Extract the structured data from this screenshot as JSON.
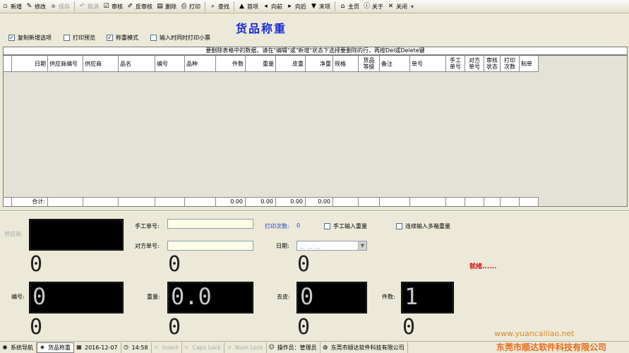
{
  "toolbar": {
    "items": [
      {
        "label": "新增",
        "icon": "new-icon",
        "glyph": "▫",
        "enabled": true
      },
      {
        "label": "修改",
        "icon": "edit-icon",
        "glyph": "✎",
        "enabled": true
      },
      {
        "label": "保存",
        "icon": "save-icon",
        "glyph": "▪",
        "enabled": false
      },
      {
        "label": "取消",
        "icon": "undo-icon",
        "glyph": "↶",
        "enabled": false
      },
      {
        "label": "审核",
        "icon": "audit-icon",
        "glyph": "☑",
        "enabled": true
      },
      {
        "label": "反审核",
        "icon": "unaudit-icon",
        "glyph": "✐",
        "enabled": true
      },
      {
        "label": "删除",
        "icon": "delete-icon",
        "glyph": "▤",
        "enabled": true
      },
      {
        "label": "打印",
        "icon": "print-icon",
        "glyph": "⎙",
        "enabled": true
      },
      {
        "label": "查找",
        "icon": "find-icon",
        "glyph": "⌕",
        "enabled": true
      },
      {
        "label": "首项",
        "icon": "first-icon",
        "glyph": "▲",
        "enabled": true
      },
      {
        "label": "向前",
        "icon": "prev-icon",
        "glyph": "◂",
        "enabled": true
      },
      {
        "label": "向后",
        "icon": "next-icon",
        "glyph": "▸",
        "enabled": true
      },
      {
        "label": "末项",
        "icon": "last-icon",
        "glyph": "▼",
        "enabled": true
      },
      {
        "label": "主页",
        "icon": "home-icon",
        "glyph": "⌂",
        "enabled": true
      },
      {
        "label": "关于",
        "icon": "about-icon",
        "glyph": "ⓘ",
        "enabled": true
      },
      {
        "label": "关闭",
        "icon": "close-icon",
        "glyph": "✕",
        "enabled": true
      }
    ]
  },
  "form": {
    "title": "货品称重",
    "options": [
      {
        "label": "复制新增选项",
        "checked": true
      },
      {
        "label": "打印预览",
        "checked": false
      },
      {
        "label": "称重模式",
        "checked": true
      },
      {
        "label": "输入时同时打印小票",
        "checked": false
      }
    ],
    "hint": "要删除表格中的数据，请在\"编辑\"或\"新增\"状态下选择要删除的行，再按Del或Delete键"
  },
  "grid": {
    "columns": [
      {
        "label": "",
        "w": 12,
        "align": "l"
      },
      {
        "label": "日期",
        "w": 51,
        "align": "r"
      },
      {
        "label": "供应商编号",
        "w": 50,
        "align": "l"
      },
      {
        "label": "供应商",
        "w": 50,
        "align": "l"
      },
      {
        "label": "品名",
        "w": 52,
        "align": "l"
      },
      {
        "label": "编号",
        "w": 42,
        "align": "l"
      },
      {
        "label": "品种",
        "w": 44,
        "align": "l"
      },
      {
        "label": "件数",
        "w": 42,
        "align": "r"
      },
      {
        "label": "重量",
        "w": 43,
        "align": "r"
      },
      {
        "label": "皮重",
        "w": 42,
        "align": "r"
      },
      {
        "label": "净重",
        "w": 39,
        "align": "r"
      },
      {
        "label": "规格",
        "w": 36,
        "align": "l"
      },
      {
        "label": "货品 等级",
        "w": 30,
        "align": "c"
      },
      {
        "label": "备注",
        "w": 43,
        "align": "l"
      },
      {
        "label": "单号",
        "w": 51,
        "align": "l"
      },
      {
        "label": "手工 单号",
        "w": 27,
        "align": "c"
      },
      {
        "label": "对方 单号",
        "w": 27,
        "align": "c"
      },
      {
        "label": "审核 状态",
        "w": 23,
        "align": "c"
      },
      {
        "label": "打印 次数",
        "w": 27,
        "align": "c"
      },
      {
        "label": "制单",
        "w": 27,
        "align": "l"
      }
    ],
    "footer": [
      "",
      "合计:",
      "",
      "",
      "",
      "",
      "",
      "0.00",
      "0.00",
      "0.00",
      "0.00",
      "",
      "",
      "",
      "",
      "",
      "",
      "",
      "",
      ""
    ]
  },
  "panel": {
    "supplier_label": "供应商:",
    "manual_no_label": "手工单号:",
    "their_no_label": "对方单号:",
    "print_count_label": "打印次数:",
    "print_count_value": "0",
    "manual_weight_label": "手工输入重量",
    "multi_weight_label": "连续输入多箱重量",
    "date_label": "日期:",
    "date_placeholder": "__-__-__",
    "status": "就绪......",
    "code_label": "编号:",
    "weight_label": "重量:",
    "tare_label": "去皮:",
    "pieces_label": "件数:",
    "code_display": "0",
    "weight_display": "0.0",
    "tare_display": "0",
    "pieces_display": "1",
    "zero": "0"
  },
  "taskbar": {
    "items": [
      {
        "label": "系统导航",
        "icon": "nav-icon",
        "glyph": "◉",
        "active": false,
        "dim": false
      },
      {
        "label": "货品称重",
        "icon": "form-icon",
        "glyph": "◈",
        "active": true,
        "dim": false
      },
      {
        "label": "2016-12-07",
        "icon": "calendar-icon",
        "glyph": "▦",
        "active": false,
        "dim": false
      },
      {
        "label": "14:58",
        "icon": "clock-icon",
        "glyph": "◷",
        "active": false,
        "dim": false
      },
      {
        "label": "Insert",
        "icon": "insert-icon",
        "glyph": "▫",
        "active": false,
        "dim": true
      },
      {
        "label": "Caps Lock",
        "icon": "capslock-icon",
        "glyph": "▫",
        "active": false,
        "dim": true
      },
      {
        "label": "Num Lock",
        "icon": "numlock-icon",
        "glyph": "▫",
        "active": false,
        "dim": true
      },
      {
        "label": "操作员：管理员",
        "icon": "user-icon",
        "glyph": "☺",
        "active": false,
        "dim": false
      },
      {
        "label": "东莞市顺达软件科技有限公司",
        "icon": "company-icon",
        "glyph": "◍",
        "active": false,
        "dim": false
      }
    ]
  },
  "watermark": {
    "url": "www.yuancailiao.net",
    "company": "东莞市顺达软件科技有限公司"
  }
}
